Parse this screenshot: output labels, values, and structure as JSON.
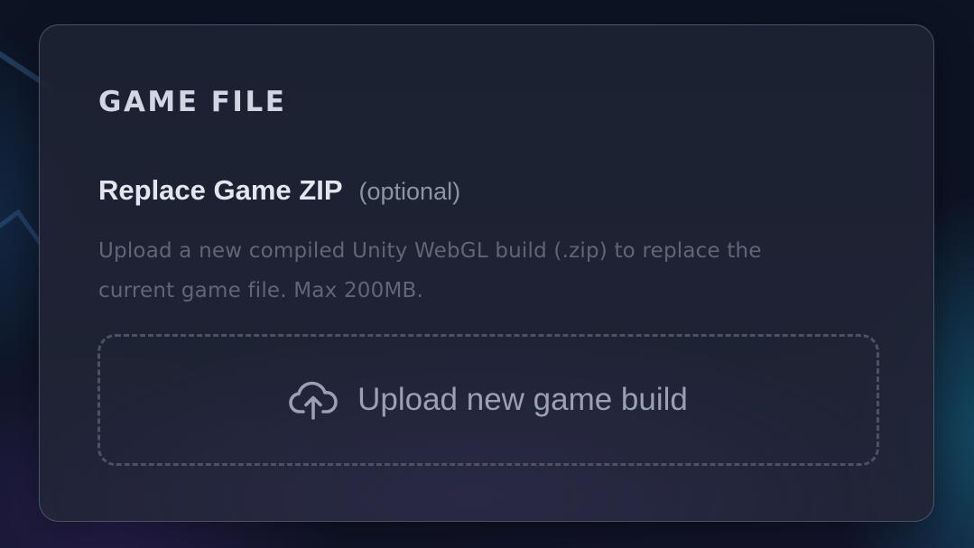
{
  "section": {
    "title": "GAME FILE"
  },
  "field": {
    "label": "Replace Game ZIP",
    "optional_hint": "(optional)",
    "help_text": "Upload a new compiled Unity WebGL build (.zip) to replace the current game file. Max 200MB."
  },
  "dropzone": {
    "icon": "cloud-upload-icon",
    "label": "Upload new game build"
  },
  "colors": {
    "background": "#0d1322",
    "card": "#21253a",
    "title": "#d2d6e2",
    "help_text": "#5f6678",
    "dropzone_border": "#4b5265",
    "dropzone_text": "#9aa1b2"
  }
}
